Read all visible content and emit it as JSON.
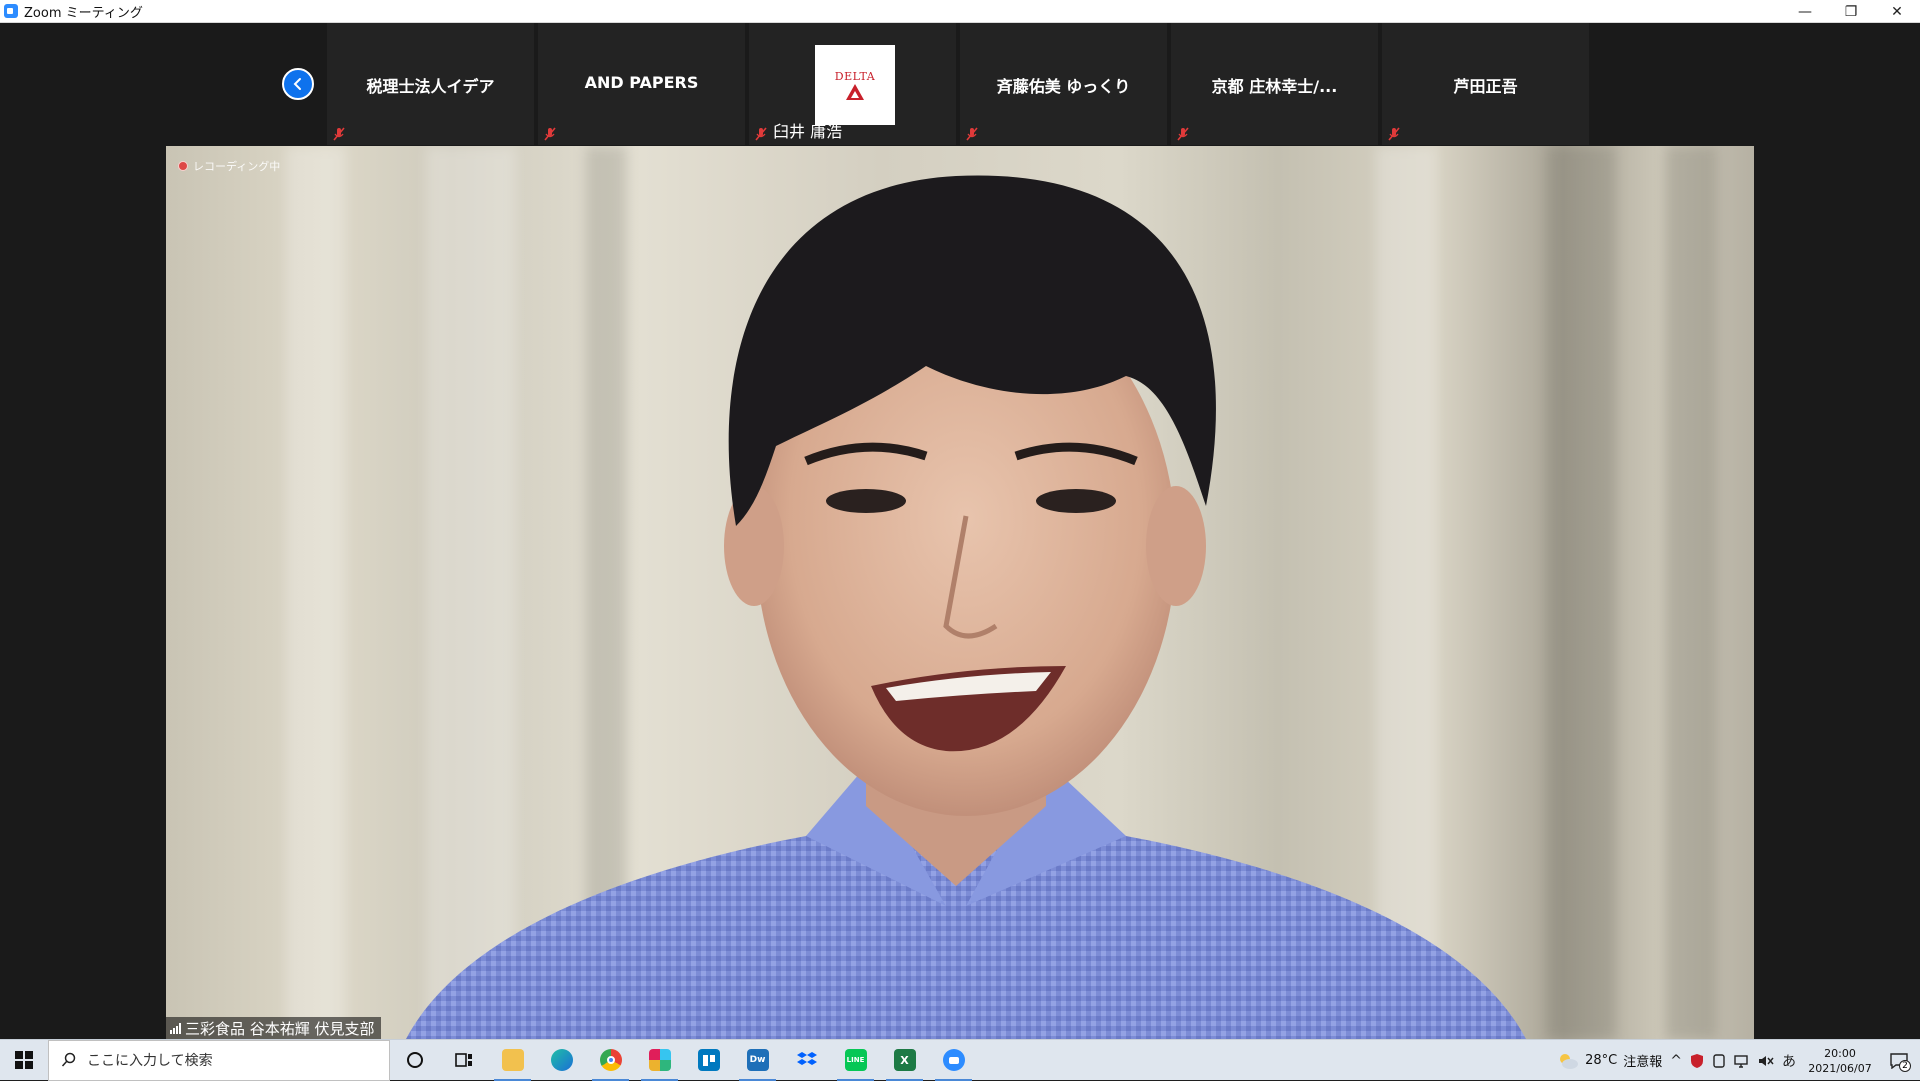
{
  "window": {
    "title": "Zoom ミーティング",
    "controls": {
      "minimize": "—",
      "restore": "❐",
      "close": "✕"
    }
  },
  "meeting": {
    "prev_page_icon": "chevron-left-icon",
    "participants": [
      {
        "name": "税理士法人イデア",
        "muted": true
      },
      {
        "name": "AND PAPERS",
        "muted": true
      },
      {
        "name": "臼井 庸浩",
        "muted": true,
        "logo_text": "DELTA"
      },
      {
        "name": "斉藤佑美 ゆっくり",
        "muted": true
      },
      {
        "name": "京都 庄林幸士/...",
        "muted": true
      },
      {
        "name": "芦田正吾",
        "muted": true
      }
    ],
    "recording_label": "レコーディング中",
    "active_speaker": "三彩食品 谷本祐輝 伏見支部"
  },
  "taskbar": {
    "search_placeholder": "ここに入力して検索",
    "apps": [
      {
        "name": "cortana-icon",
        "active": false
      },
      {
        "name": "task-view-icon",
        "active": false
      },
      {
        "name": "file-explorer-icon",
        "active": true
      },
      {
        "name": "edge-icon",
        "active": false
      },
      {
        "name": "chrome-icon",
        "active": true
      },
      {
        "name": "slack-icon",
        "active": true
      },
      {
        "name": "trello-icon",
        "active": false
      },
      {
        "name": "dreamweaver-icon",
        "active": true
      },
      {
        "name": "dropbox-icon",
        "active": false
      },
      {
        "name": "line-icon",
        "active": true
      },
      {
        "name": "excel-icon",
        "active": true
      },
      {
        "name": "zoom-icon",
        "active": true
      }
    ],
    "tray": {
      "temperature": "28°C",
      "weather_alert": "注意報",
      "ime": "あ",
      "time": "20:00",
      "date": "2021/06/07",
      "notification_count": "2"
    }
  }
}
